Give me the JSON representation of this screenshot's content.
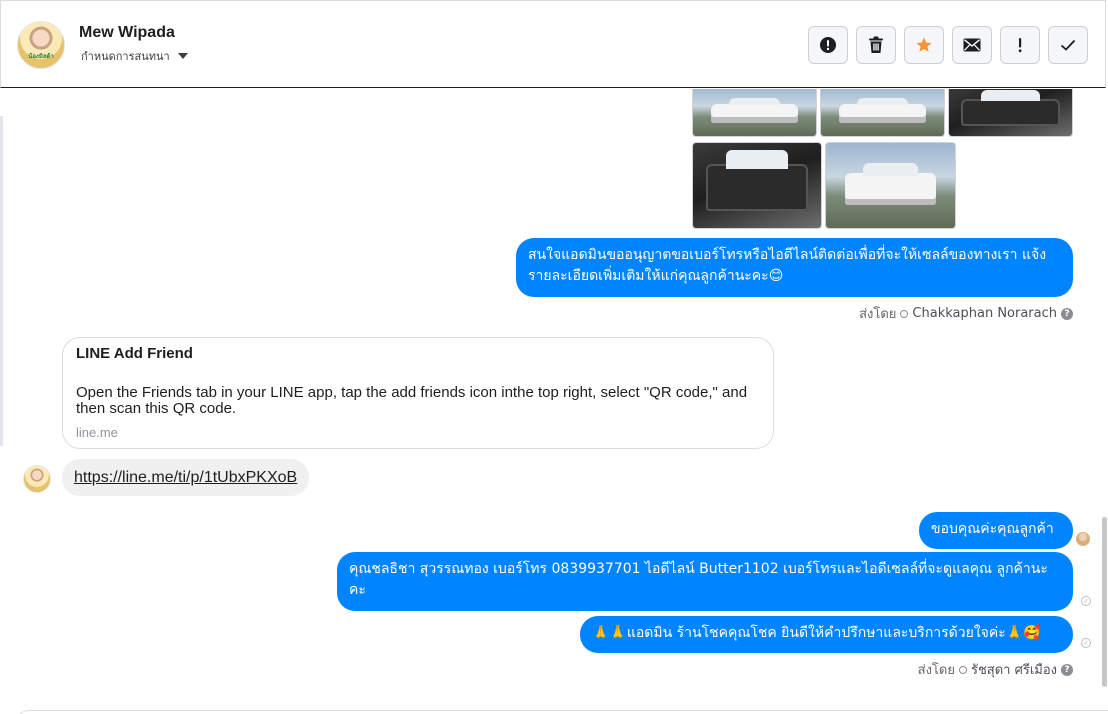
{
  "header": {
    "contact_name": "Mew Wipada",
    "assign_label": "กำหนดการสนทนา",
    "avatar_caption": "น้องมิลด้า",
    "actions": [
      {
        "name": "mark-spam-button",
        "icon": "alert-circle-icon",
        "glyph": "!"
      },
      {
        "name": "delete-button",
        "icon": "trash-icon"
      },
      {
        "name": "star-button",
        "icon": "star-icon",
        "color": "#f7923a"
      },
      {
        "name": "mark-unread-button",
        "icon": "envelope-icon"
      },
      {
        "name": "follow-up-button",
        "icon": "exclamation-icon",
        "glyph": "!"
      },
      {
        "name": "mark-done-button",
        "icon": "check-icon"
      }
    ]
  },
  "messages": {
    "outgoing_1": "สนใจแอดมินขออนุญาตขอเบอร์โทรหรือไอดีไลน์ติดต่อเพื่อที่จะให้เซลล์ของทางเรา แจ้งรายละเอียดเพิ่มเติมให้แก่คุณลูกค้านะคะ😊",
    "sent_by_1_prefix": "ส่งโดย",
    "sent_by_1_agent": "Chakkaphan Norarach",
    "link_card": {
      "title": "LINE Add Friend",
      "description": "Open the Friends tab in your LINE app, tap the add friends icon inthe top right, select \"QR code,\" and then scan this QR code.",
      "domain": "line.me"
    },
    "incoming_link": "https://line.me/ti/p/1tUbxPKXoB",
    "outgoing_2": "ขอบคุณค่ะคุณลูกค้า",
    "outgoing_3": "คุณชลธิชา สุวรรณทอง   เบอร์โทร 0839937701  ไอดีไลน์ Butter1102   เบอร์โทรและไอดีเซลล์ที่จะดูแลคุณ ลูกค้านะคะ",
    "outgoing_4": "🙏🙏แอดมิน ร้านโชคคุณโชค ยินดีให้คำปรึกษาและบริการด้วยใจค่ะ🙏🥰",
    "sent_by_2_prefix": "ส่งโดย",
    "sent_by_2_agent": "รัชสุดา ศรีเมือง"
  },
  "colors": {
    "bubble_out": "#0084ff",
    "bubble_in": "#f0f0f0",
    "star": "#f7923a"
  }
}
